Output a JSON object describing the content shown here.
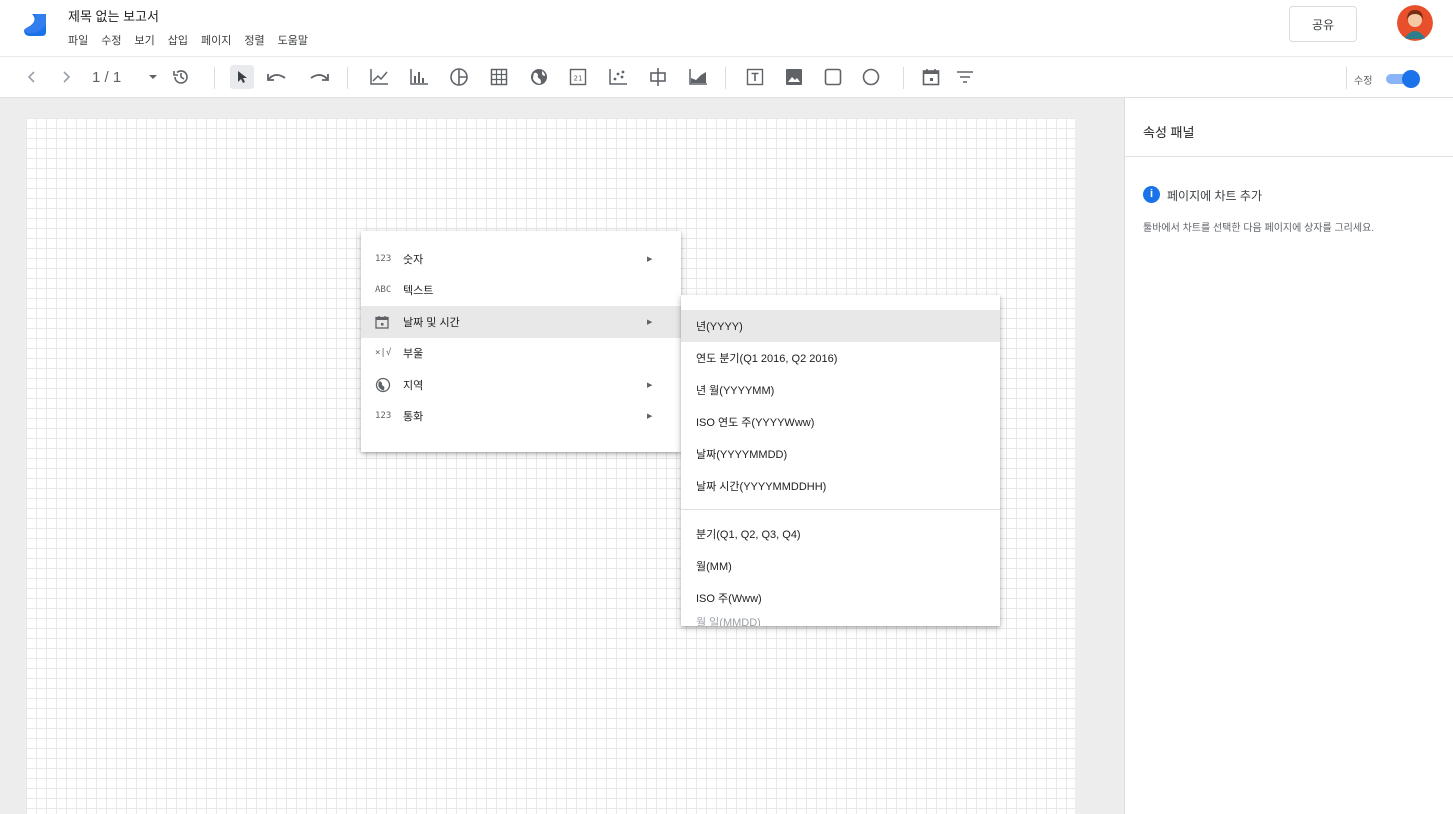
{
  "header": {
    "doc_title": "제목 없는 보고서",
    "menu": [
      "파일",
      "수정",
      "보기",
      "삽입",
      "페이지",
      "정렬",
      "도움말"
    ],
    "share_label": "공유"
  },
  "toolbar": {
    "page_indicator": "1 / 1",
    "edit_label": "수정",
    "edit_mode_on": true
  },
  "panel": {
    "title": "속성 패널",
    "info_heading": "페이지에 차트 추가",
    "info_body": "툴바에서 차트를 선택한 다음 페이지에 상자를 그리세요."
  },
  "type_menu": {
    "items": [
      {
        "icon": "123",
        "label": "숫자",
        "has_submenu": true
      },
      {
        "icon": "ABC",
        "label": "텍스트",
        "has_submenu": false
      },
      {
        "icon": "calendar-icon",
        "label": "날짜 및 시간",
        "has_submenu": true,
        "active": true
      },
      {
        "icon": "×|√",
        "label": "부울",
        "has_submenu": false
      },
      {
        "icon": "globe-icon",
        "label": "지역",
        "has_submenu": true
      },
      {
        "icon": "123",
        "label": "통화",
        "has_submenu": true
      }
    ]
  },
  "date_submenu": {
    "group1": [
      "년(YYYY)",
      "연도 분기(Q1 2016, Q2 2016)",
      "년 월(YYYYMM)",
      "ISO 연도 주(YYYYWww)",
      "날짜(YYYYMMDD)",
      "날짜 시간(YYYYMMDDHH)"
    ],
    "group2": [
      "분기(Q1, Q2, Q3, Q4)",
      "월(MM)",
      "ISO 주(Www)",
      "월 일(MMDD)"
    ],
    "active_index": 0
  },
  "colors": {
    "accent": "#1a73e8",
    "menu_active": "#e8e8e8",
    "workspace_bg": "#ededed"
  }
}
